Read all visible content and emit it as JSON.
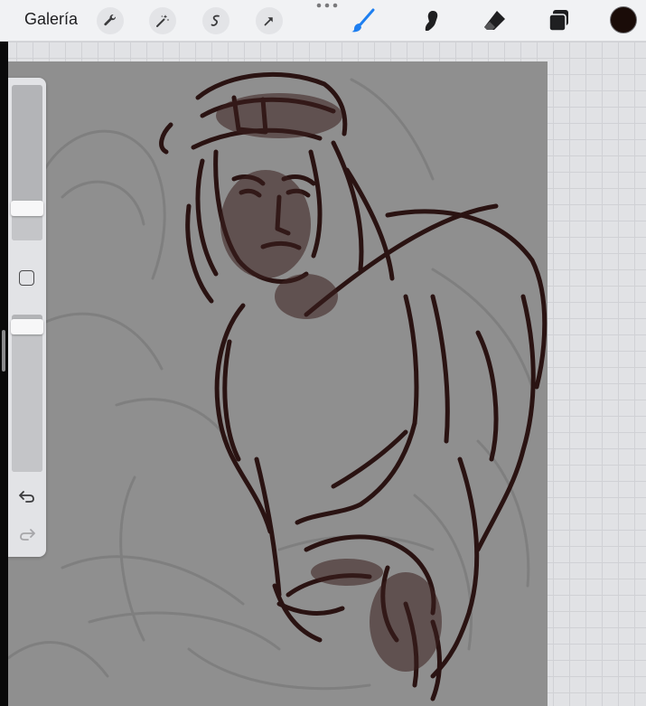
{
  "topbar": {
    "gallery_label": "Galería",
    "left_tools": [
      {
        "name": "wrench-icon",
        "label": "actions"
      },
      {
        "name": "magic-wand-icon",
        "label": "adjustments"
      },
      {
        "name": "selection-icon",
        "label": "selection"
      },
      {
        "name": "transform-arrow-icon",
        "label": "transform"
      }
    ],
    "right_tools": [
      {
        "name": "brush-icon",
        "active": true
      },
      {
        "name": "smudge-icon",
        "active": false
      },
      {
        "name": "eraser-icon",
        "active": false
      },
      {
        "name": "layers-icon",
        "active": false
      }
    ],
    "current_color": "#1a0c08",
    "active_tool_color": "#1e7ff0"
  },
  "sidebar": {
    "brush_size_level": 0.21,
    "opacity_level": 0.95,
    "modify_button_icon": "square-icon",
    "undo_icon": "undo-icon",
    "redo_icon": "redo-icon"
  },
  "canvas": {
    "background_color": "#8f8f8f",
    "stroke_color": "#2a1312"
  }
}
